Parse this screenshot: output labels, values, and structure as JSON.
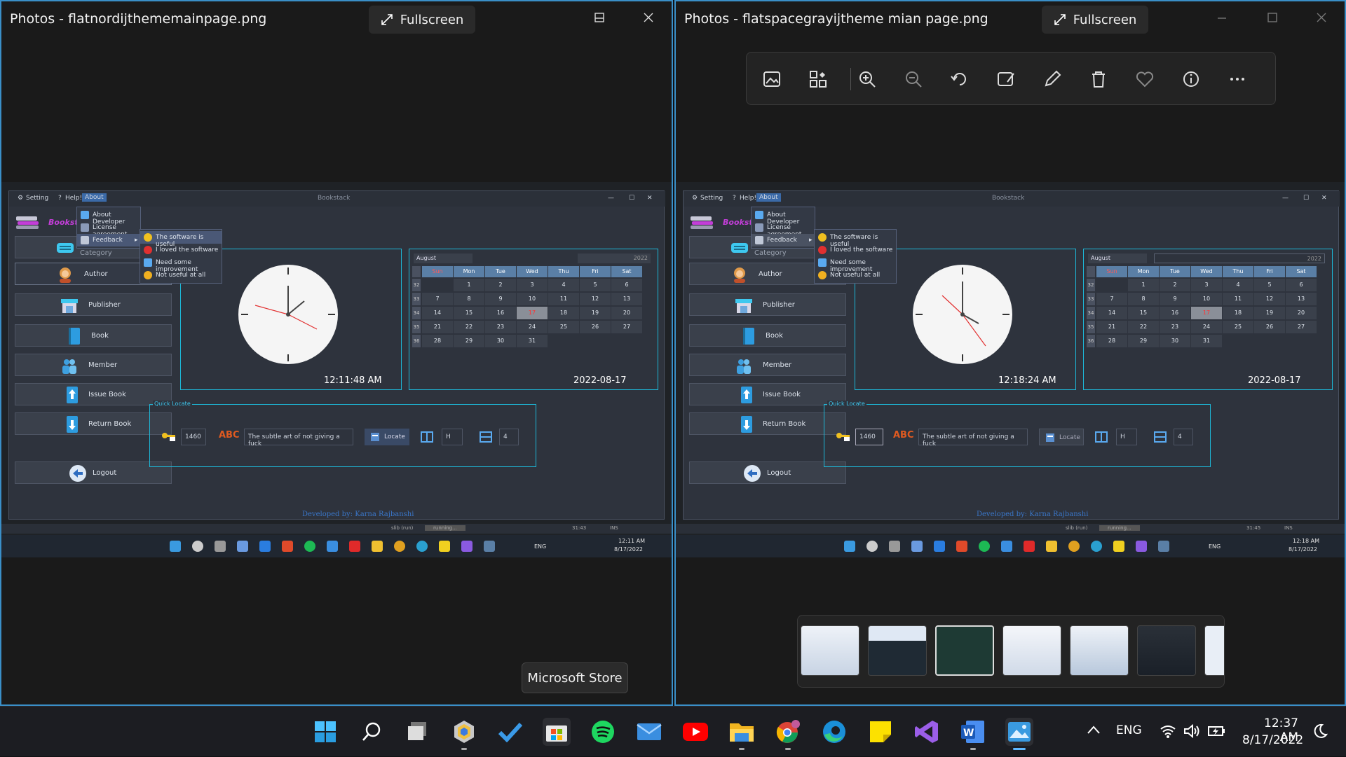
{
  "left_window": {
    "title": "Photos - flatnordijthememainpage.png",
    "fullscreen_label": "Fullscreen",
    "screenshot": {
      "menu": {
        "setting": "Setting",
        "help": "Help!",
        "about": "About",
        "window_title": "Bookstack"
      },
      "brand": "Bookstack:",
      "about_menu": [
        "About Developer",
        "License agreement",
        "Feedback"
      ],
      "feedback_menu": [
        "The software is useful",
        "I loved the software",
        "Need some improvement",
        "Not useful at all"
      ],
      "sidebar": [
        "Category",
        "Author",
        "Publisher",
        "Book",
        "Member",
        "Issue Book",
        "Return Book",
        "Logout"
      ],
      "clock_time": "12:11:48 AM",
      "date": "2022-08-17",
      "calendar": {
        "month": "August",
        "year": "2022",
        "days": [
          "Sun",
          "Mon",
          "Tue",
          "Wed",
          "Thu",
          "Fri",
          "Sat"
        ],
        "weeks": [
          "32",
          "33",
          "34",
          "35",
          "36"
        ],
        "dates": [
          "",
          "1",
          "2",
          "3",
          "4",
          "5",
          "6",
          "7",
          "8",
          "9",
          "10",
          "11",
          "12",
          "13",
          "14",
          "15",
          "16",
          "17",
          "18",
          "19",
          "20",
          "21",
          "22",
          "23",
          "24",
          "25",
          "26",
          "27",
          "28",
          "29",
          "30",
          "31"
        ],
        "selected": "17"
      },
      "quick_locate": {
        "label": "Quick Locate",
        "id_value": "1460",
        "book_title": "The subtle art of not giving a fuck",
        "locate_label": "Locate",
        "col_value": "H",
        "row_value": "4"
      },
      "footer": "Developed by: Karna Rajbanshi",
      "status": {
        "run": "slib (run)",
        "running": "running...",
        "pos": "31:43",
        "mode": "INS"
      },
      "taskbar": {
        "lang": "ENG",
        "time": "12:11 AM",
        "date": "8/17/2022"
      }
    }
  },
  "right_window": {
    "title": "Photos - flatspacegrayijtheme mian page.png",
    "fullscreen_label": "Fullscreen",
    "screenshot": {
      "clock_time": "12:18:24 AM",
      "date": "2022-08-17",
      "status": {
        "run": "slib (run)",
        "running": "running...",
        "pos": "31:45",
        "mode": "INS"
      },
      "taskbar": {
        "lang": "ENG",
        "time": "12:18 AM",
        "date": "8/17/2022"
      }
    }
  },
  "tooltip": "Microsoft Store",
  "taskbar": {
    "lang": "ENG",
    "time": "12:37 AM",
    "date": "8/17/2022"
  }
}
